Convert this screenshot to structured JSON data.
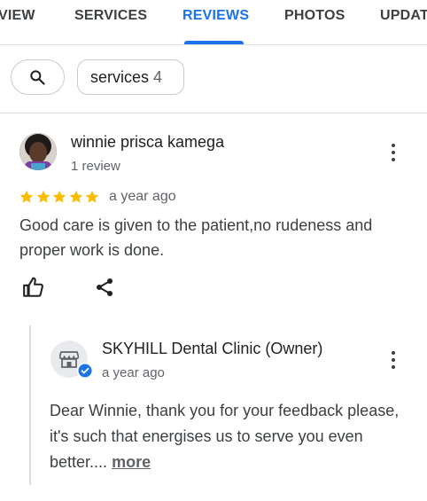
{
  "tabs": [
    {
      "label": "VIEW"
    },
    {
      "label": "SERVICES"
    },
    {
      "label": "REVIEWS"
    },
    {
      "label": "PHOTOS"
    },
    {
      "label": "UPDAT"
    }
  ],
  "active_tab": "REVIEWS",
  "filters": {
    "search_icon": "search-icon",
    "chip_label": "services",
    "chip_count": "4"
  },
  "review": {
    "author": "winnie prisca kamega",
    "author_meta": "1 review",
    "rating": 5,
    "date": "a year ago",
    "text": "Good care is given to the patient,no rudeness and proper work is done.",
    "actions": [
      "thumbs-up-icon",
      "share-icon"
    ]
  },
  "owner_reply": {
    "name": "SKYHILL Dental Clinic (Owner)",
    "date": "a year ago",
    "text": "Dear Winnie, thank you for your feedback please, it's such that energises us to serve you even better....",
    "more_label": "more"
  },
  "colors": {
    "accent": "#1a73e8",
    "star": "#fbbc04",
    "verified": "#1a73e8"
  }
}
